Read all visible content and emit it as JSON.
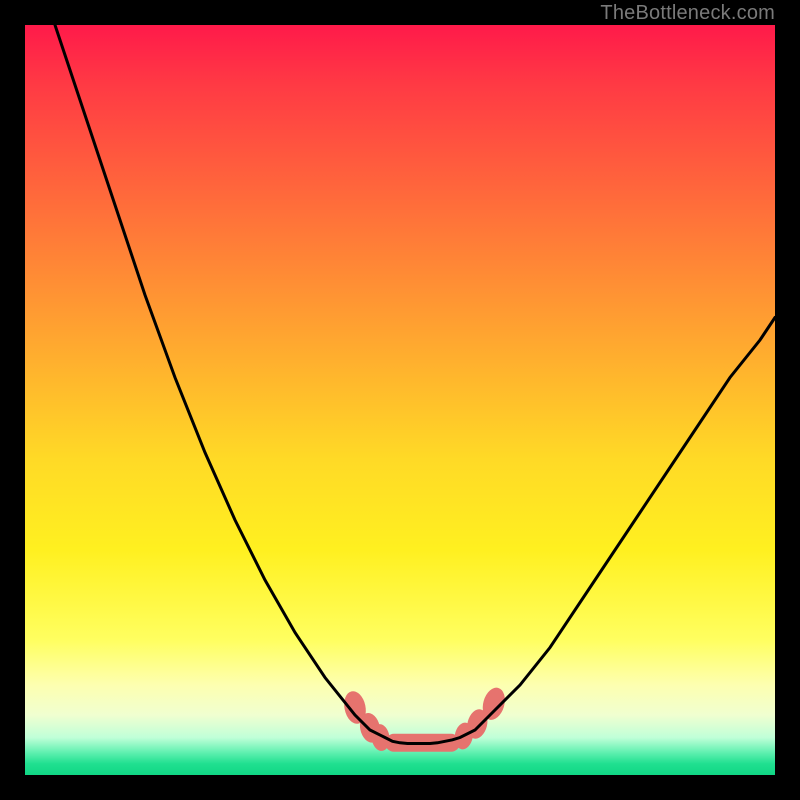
{
  "watermark": {
    "text": "TheBottleneck.com"
  },
  "chart_data": {
    "type": "line",
    "title": "",
    "xlabel": "",
    "ylabel": "",
    "xlim": [
      0,
      100
    ],
    "ylim": [
      0,
      100
    ],
    "series": [
      {
        "name": "curve-left",
        "x": [
          4,
          8,
          12,
          16,
          20,
          24,
          28,
          32,
          36,
          40,
          44,
          46,
          48
        ],
        "y": [
          100,
          88,
          76,
          64,
          53,
          43,
          34,
          26,
          19,
          13,
          8,
          6,
          5
        ]
      },
      {
        "name": "curve-right",
        "x": [
          58,
          60,
          62,
          66,
          70,
          74,
          78,
          82,
          86,
          90,
          94,
          98,
          100
        ],
        "y": [
          5,
          6,
          8,
          12,
          17,
          23,
          29,
          35,
          41,
          47,
          53,
          58,
          61
        ]
      },
      {
        "name": "flat-bottom",
        "x": [
          48,
          49,
          50,
          51,
          52,
          53,
          54,
          55,
          56,
          57,
          58
        ],
        "y": [
          5,
          4.5,
          4.3,
          4.2,
          4.2,
          4.2,
          4.2,
          4.3,
          4.5,
          4.7,
          5
        ]
      }
    ],
    "markers": [
      {
        "name": "marker-left-upper",
        "cx": 44.0,
        "cy": 9.0,
        "rx": 1.4,
        "ry": 2.2,
        "rot": -12
      },
      {
        "name": "marker-left-mid",
        "cx": 46.0,
        "cy": 6.3,
        "rx": 1.3,
        "ry": 2.0,
        "rot": -12
      },
      {
        "name": "marker-left-low",
        "cx": 47.4,
        "cy": 5.0,
        "rx": 1.2,
        "ry": 1.8,
        "rot": -8
      },
      {
        "name": "marker-right-low",
        "cx": 58.5,
        "cy": 5.2,
        "rx": 1.2,
        "ry": 1.8,
        "rot": 10
      },
      {
        "name": "marker-right-mid",
        "cx": 60.3,
        "cy": 6.8,
        "rx": 1.3,
        "ry": 2.0,
        "rot": 14
      },
      {
        "name": "marker-right-upper",
        "cx": 62.5,
        "cy": 9.5,
        "rx": 1.4,
        "ry": 2.2,
        "rot": 16
      }
    ],
    "flat_band": {
      "x0": 48,
      "x1": 58,
      "y": 4.3,
      "thickness": 2.4
    },
    "colors": {
      "curve": "#000000",
      "marker": "#e6736e",
      "band": "#e6736e"
    }
  }
}
